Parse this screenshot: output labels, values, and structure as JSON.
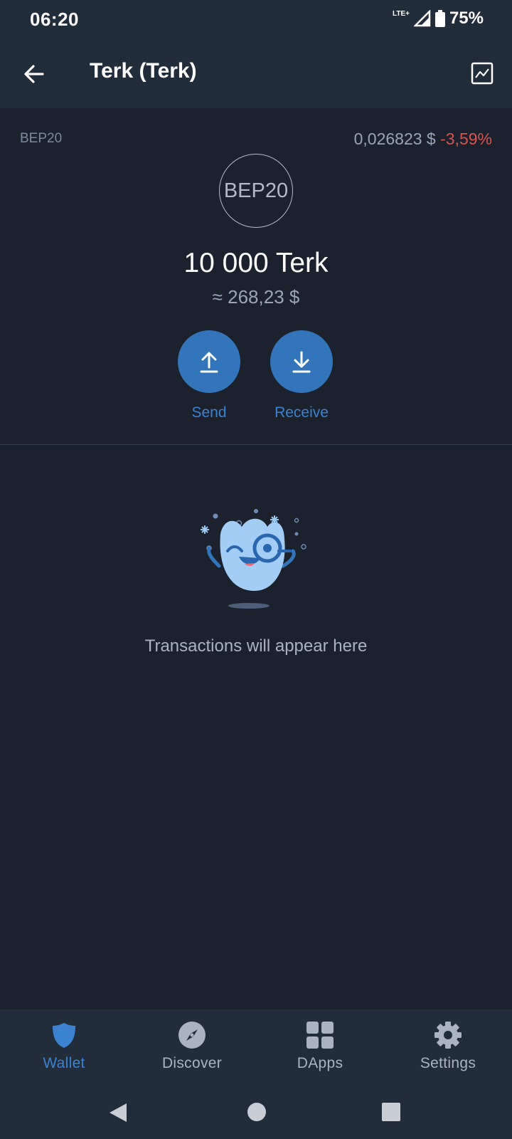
{
  "status_bar": {
    "time": "06:20",
    "network": "LTE+",
    "battery": "75%"
  },
  "app_bar": {
    "title": "Terk (Terk)"
  },
  "token": {
    "standard": "BEP20",
    "price": "0,026823 $",
    "change": "-3,59%",
    "logo_text": "BEP20",
    "balance": "10 000 Terk",
    "fiat_value": "≈ 268,23 $"
  },
  "actions": {
    "send_label": "Send",
    "receive_label": "Receive"
  },
  "empty_state": {
    "message": "Transactions will appear here"
  },
  "bottom_nav": {
    "items": [
      {
        "label": "Wallet",
        "icon": "shield-icon",
        "active": true
      },
      {
        "label": "Discover",
        "icon": "compass-icon",
        "active": false
      },
      {
        "label": "DApps",
        "icon": "grid-icon",
        "active": false
      },
      {
        "label": "Settings",
        "icon": "gear-icon",
        "active": false
      }
    ]
  },
  "colors": {
    "background": "#1b222e",
    "bar": "#222d3c",
    "accent": "#3375bb",
    "negative": "#d9534f"
  }
}
